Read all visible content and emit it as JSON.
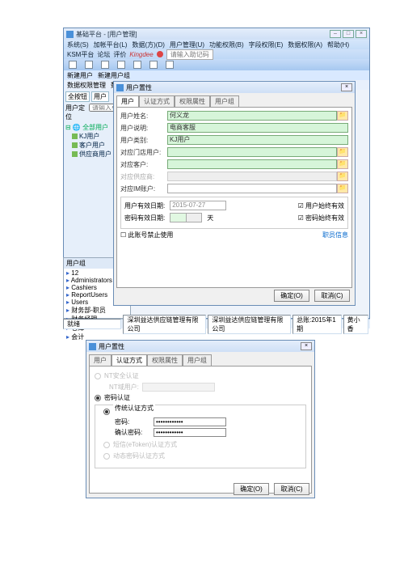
{
  "main_window": {
    "title": "基础平台 - [用户管理]",
    "menubar": [
      "系统(S)",
      "加帐平台(L)",
      "数据(方)(D)",
      "用户管理(U)",
      "功能权限(B)",
      "字段权限(E)",
      "数据权限(A)",
      "帮助(H)"
    ],
    "submenu_left": [
      "KSM平台",
      "论坛",
      "评价",
      "Kingdee"
    ],
    "submenu_hint": "请输入助记码",
    "toolbar_row2": [
      "新建用户",
      "新建用户组"
    ],
    "toolbar_row3": [
      "数据权限管理",
      "数据"
    ],
    "side_tabs": [
      "全按钮",
      "用户"
    ],
    "side_loc": {
      "label": "用户定位",
      "hint": "请输入要查"
    },
    "tree_root": "全部用户",
    "tree_nodes": [
      "KJ用户",
      "客户用户",
      "供应商用户"
    ],
    "group_title": "用户组",
    "groups": [
      "12",
      "Administrators",
      "Cashiers",
      "ReportUsers",
      "Users",
      "财务部-职员",
      "财务经理",
      "仓库",
      "会计"
    ],
    "status_left": "就绪",
    "status_mid1": "深圳益达供应链管理有限公司",
    "status_mid2": "深圳益达供应链管理有限公司",
    "status_date": "总账:2015年1期",
    "status_user": "黄小香"
  },
  "dialog1": {
    "title": "用户置性",
    "tabs": [
      "用户",
      "认证方式",
      "权限属性",
      "用户组"
    ],
    "fields": {
      "name_lbl": "用户姓名:",
      "name_val": "何义龙",
      "desc_lbl": "用户说明:",
      "desc_val": "电商客服",
      "type_lbl": "用户类别:",
      "type_val": "KJ用户",
      "store_lbl": "对应门店用户:",
      "cust_lbl": "对应客户:",
      "vend_lbl": "对应供应商:",
      "im_lbl": "对应IM账户:"
    },
    "dates": {
      "expire_lbl": "用户有效日期:",
      "expire_val": "2015-07-27",
      "chk1_lbl": "用户始终有效",
      "pwd_lbl": "密码有效日期:",
      "days_unit": "天",
      "chk2_lbl": "密码始终有效"
    },
    "footer": {
      "chk_disable": "此账号禁止使用",
      "link_emp": "职员信息"
    },
    "buttons": {
      "ok": "确定(O)",
      "cancel": "取消(C)"
    }
  },
  "dialog2": {
    "title": "用户置性",
    "tabs": [
      "用户",
      "认证方式",
      "权限属性",
      "用户组"
    ],
    "rad_nt": "NT安全认证",
    "nt_domain_lbl": "NT域用户:",
    "rad_pwd": "密码认证",
    "fs_legend": "传统认证方式",
    "pwd_lbl": "密码:",
    "pwd_confirm_lbl": "确认密码:",
    "pwd_mask": "************",
    "rad_sms": "短信(eToken)认证方式",
    "rad_dyn": "动态密码认证方式",
    "buttons": {
      "ok": "确定(O)",
      "cancel": "取消(C)"
    }
  }
}
